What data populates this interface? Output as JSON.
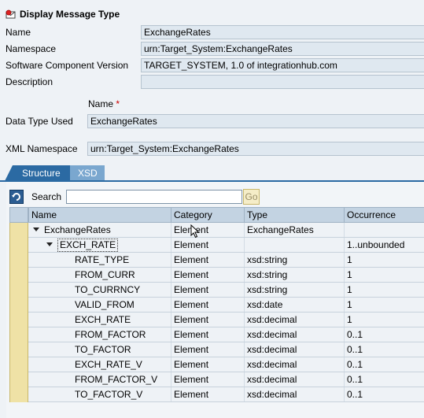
{
  "window": {
    "title": "Display Message Type"
  },
  "form": {
    "name_label": "Name",
    "name_value": "ExchangeRates",
    "namespace_label": "Namespace",
    "namespace_value": "urn:Target_System:ExchangeRates",
    "swcv_label": "Software Component Version",
    "swcv_value": "TARGET_SYSTEM, 1.0 of integrationhub.com",
    "description_label": "Description",
    "description_value": "",
    "datatype_name_label": "Name",
    "required_marker": "*",
    "datatype_label": "Data Type Used",
    "datatype_value": "ExchangeRates",
    "xmlns_label": "XML Namespace",
    "xmlns_value": "urn:Target_System:ExchangeRates"
  },
  "tabs": [
    {
      "label": "Structure",
      "active": true
    },
    {
      "label": "XSD",
      "active": false
    }
  ],
  "toolbar": {
    "search_label": "Search",
    "search_value": "",
    "go_label": "Go"
  },
  "grid": {
    "columns": [
      "Name",
      "Category",
      "Type",
      "Occurrence"
    ],
    "rows": [
      {
        "name": "ExchangeRates",
        "category": "Element",
        "type": "ExchangeRates",
        "occurrence": ""
      },
      {
        "name": "EXCH_RATE",
        "category": "Element",
        "type": "",
        "occurrence": "1..unbounded"
      },
      {
        "name": "RATE_TYPE",
        "category": "Element",
        "type": "xsd:string",
        "occurrence": "1"
      },
      {
        "name": "FROM_CURR",
        "category": "Element",
        "type": "xsd:string",
        "occurrence": "1"
      },
      {
        "name": "TO_CURRNCY",
        "category": "Element",
        "type": "xsd:string",
        "occurrence": "1"
      },
      {
        "name": "VALID_FROM",
        "category": "Element",
        "type": "xsd:date",
        "occurrence": "1"
      },
      {
        "name": "EXCH_RATE",
        "category": "Element",
        "type": "xsd:decimal",
        "occurrence": "1"
      },
      {
        "name": "FROM_FACTOR",
        "category": "Element",
        "type": "xsd:decimal",
        "occurrence": "0..1"
      },
      {
        "name": "TO_FACTOR",
        "category": "Element",
        "type": "xsd:decimal",
        "occurrence": "0..1"
      },
      {
        "name": "EXCH_RATE_V",
        "category": "Element",
        "type": "xsd:decimal",
        "occurrence": "0..1"
      },
      {
        "name": "FROM_FACTOR_V",
        "category": "Element",
        "type": "xsd:decimal",
        "occurrence": "0..1"
      },
      {
        "name": "TO_FACTOR_V",
        "category": "Element",
        "type": "xsd:decimal",
        "occurrence": "0..1"
      }
    ]
  },
  "colors": {
    "tab_active": "#2b6aa3",
    "tab_inactive": "#7aa7cf",
    "field_bg": "#dfe8f0",
    "header_bg": "#c3d3e2",
    "select_cell": "#efe2a6"
  }
}
